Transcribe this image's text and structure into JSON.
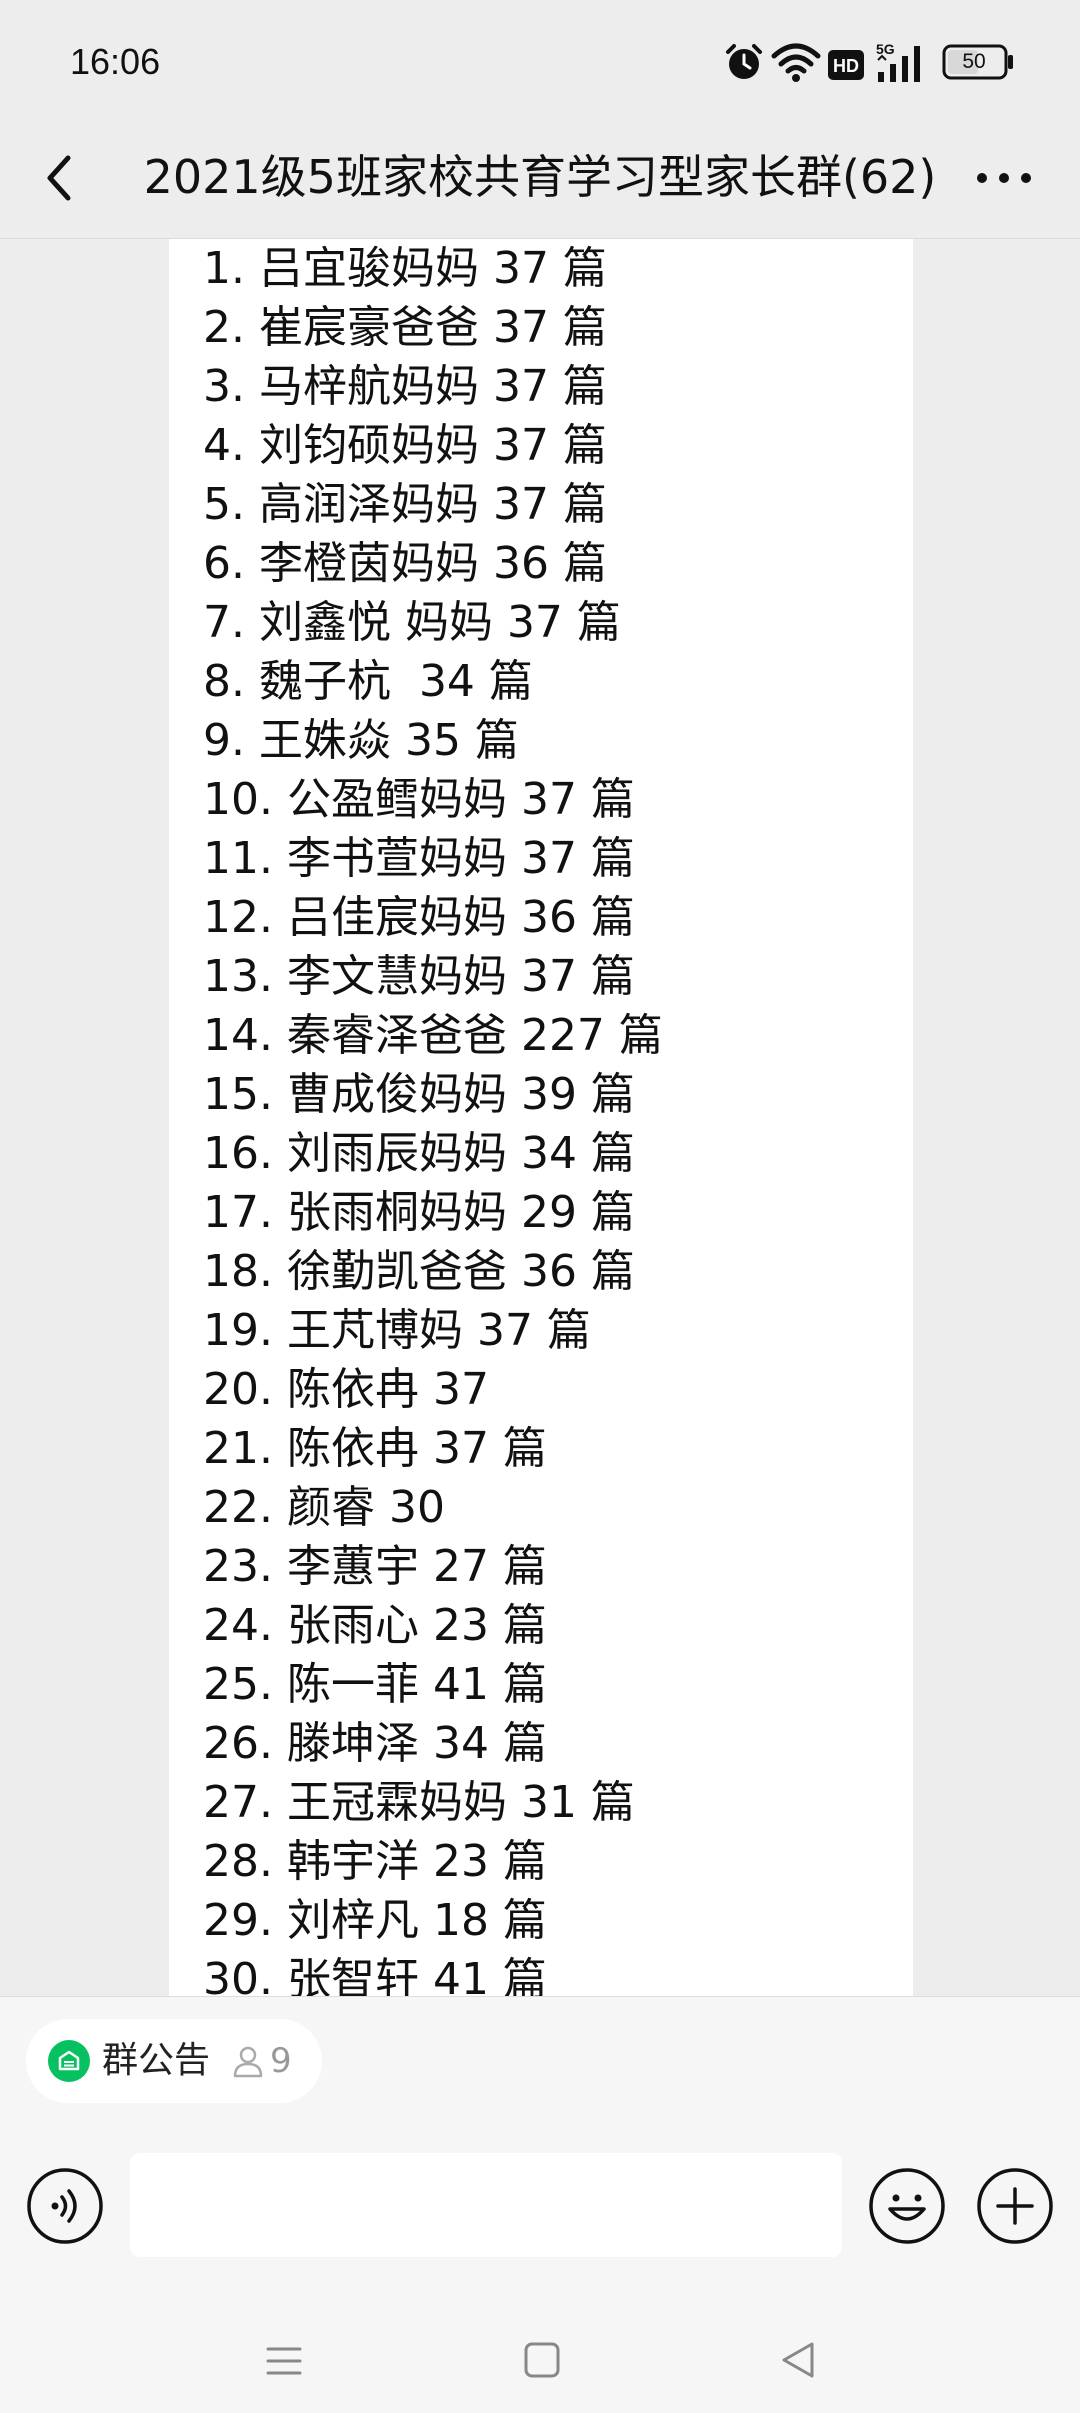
{
  "status_bar": {
    "time": "16:06",
    "battery": "50",
    "hd_label": "HD",
    "network_label": "5G"
  },
  "header": {
    "title": "2021级5班家校共育学习型家长群(62)"
  },
  "message": {
    "lines": [
      "1. 吕宜骏妈妈 37 篇",
      "2. 崔宸豪爸爸 37 篇",
      "3. 马梓航妈妈 37 篇",
      "4. 刘钧硕妈妈 37 篇",
      "5. 高润泽妈妈 37 篇",
      "6. 李橙茵妈妈 36 篇",
      "7. 刘鑫悦 妈妈 37 篇",
      "8. 魏子杭  34 篇",
      "9. 王姝焱 35 篇",
      "10. 公盈鳕妈妈 37 篇",
      "11. 李书萱妈妈 37 篇",
      "12. 吕佳宸妈妈 36 篇",
      "13. 李文慧妈妈 37 篇",
      "14. 秦睿泽爸爸 227 篇",
      "15. 曹成俊妈妈 39 篇",
      "16. 刘雨辰妈妈 34 篇",
      "17. 张雨桐妈妈 29 篇",
      "18. 徐勤凯爸爸 36 篇",
      "19. 王芃博妈 37 篇",
      "20. 陈依冉 37",
      "21. 陈依冉 37 篇",
      "22. 颜睿 30",
      "23. 李蕙宇 27 篇",
      "24. 张雨心 23 篇",
      "25. 陈一菲 41 篇",
      "26. 滕坤泽 34 篇",
      "27. 王冠霖妈妈 31 篇",
      "28. 韩宇洋 23 篇",
      "29. 刘梓凡 18 篇",
      "30. 张智轩 41 篇"
    ]
  },
  "bottom": {
    "announcement_label": "群公告",
    "announcement_count": "9",
    "input_value": ""
  },
  "colors": {
    "background": "#ededed",
    "card": "#ffffff",
    "announcement_green": "#07c160"
  },
  "icons": [
    "back-arrow-icon",
    "more-dots-icon",
    "alarm-icon",
    "wifi-icon",
    "signal-icon",
    "battery-icon",
    "megaphone-icon",
    "person-icon",
    "voice-icon",
    "emoji-icon",
    "plus-icon",
    "nav-menu-icon",
    "nav-home-icon",
    "nav-back-icon"
  ]
}
